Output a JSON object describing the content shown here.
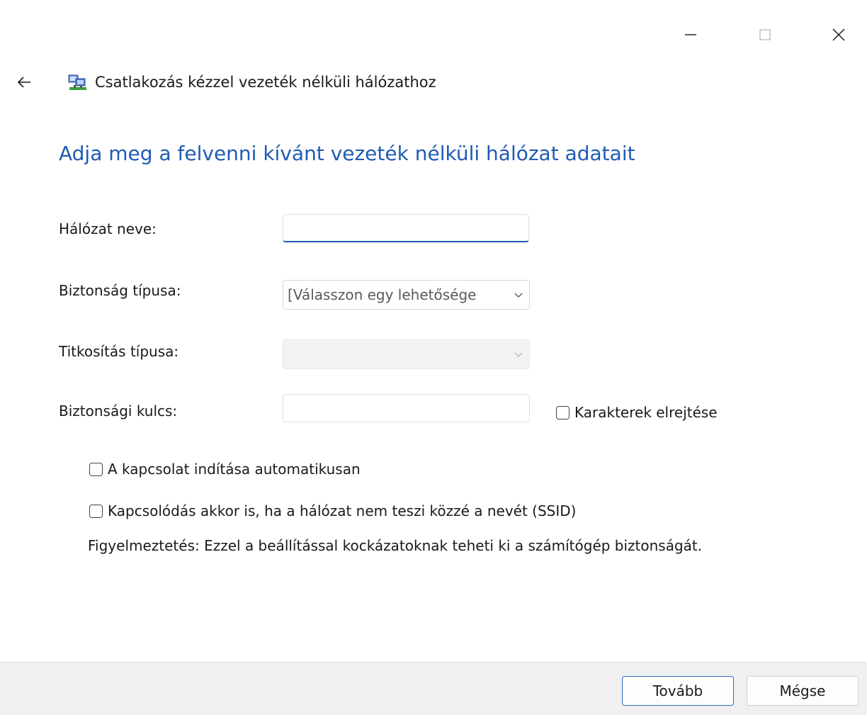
{
  "window": {
    "minimize_icon": "minimize-icon",
    "maximize_icon": "maximize-icon",
    "close_icon": "close-icon"
  },
  "header": {
    "back_icon": "back-arrow-icon",
    "app_icon": "network-icon",
    "title": "Csatlakozás kézzel vezeték nélküli hálózathoz"
  },
  "main": {
    "heading": "Adja meg a felvenni kívánt vezeték nélküli hálózat adatait",
    "network_name": {
      "label": "Hálózat neve:",
      "value": ""
    },
    "security_type": {
      "label": "Biztonság típusa:",
      "selected": "[Válasszon egy lehetősége"
    },
    "encryption_type": {
      "label": "Titkosítás típusa:",
      "selected": ""
    },
    "security_key": {
      "label": "Biztonsági kulcs:",
      "value": "",
      "hide_chars_label": "Karakterek elrejtése",
      "hide_chars_checked": false
    },
    "auto_start": {
      "label": "A kapcsolat indítása automatikusan",
      "checked": false
    },
    "hidden_network": {
      "label": "Kapcsolódás akkor is, ha a hálózat nem teszi közzé a nevét (SSID)",
      "checked": false
    },
    "warning": "Figyelmeztetés: Ezzel a beállítással kockázatoknak teheti ki a számítógép biztonságát."
  },
  "footer": {
    "next_label": "Tovább",
    "cancel_label": "Mégse"
  },
  "colors": {
    "accent": "#1f5bb5",
    "footer_bg": "#f0f0f0"
  }
}
